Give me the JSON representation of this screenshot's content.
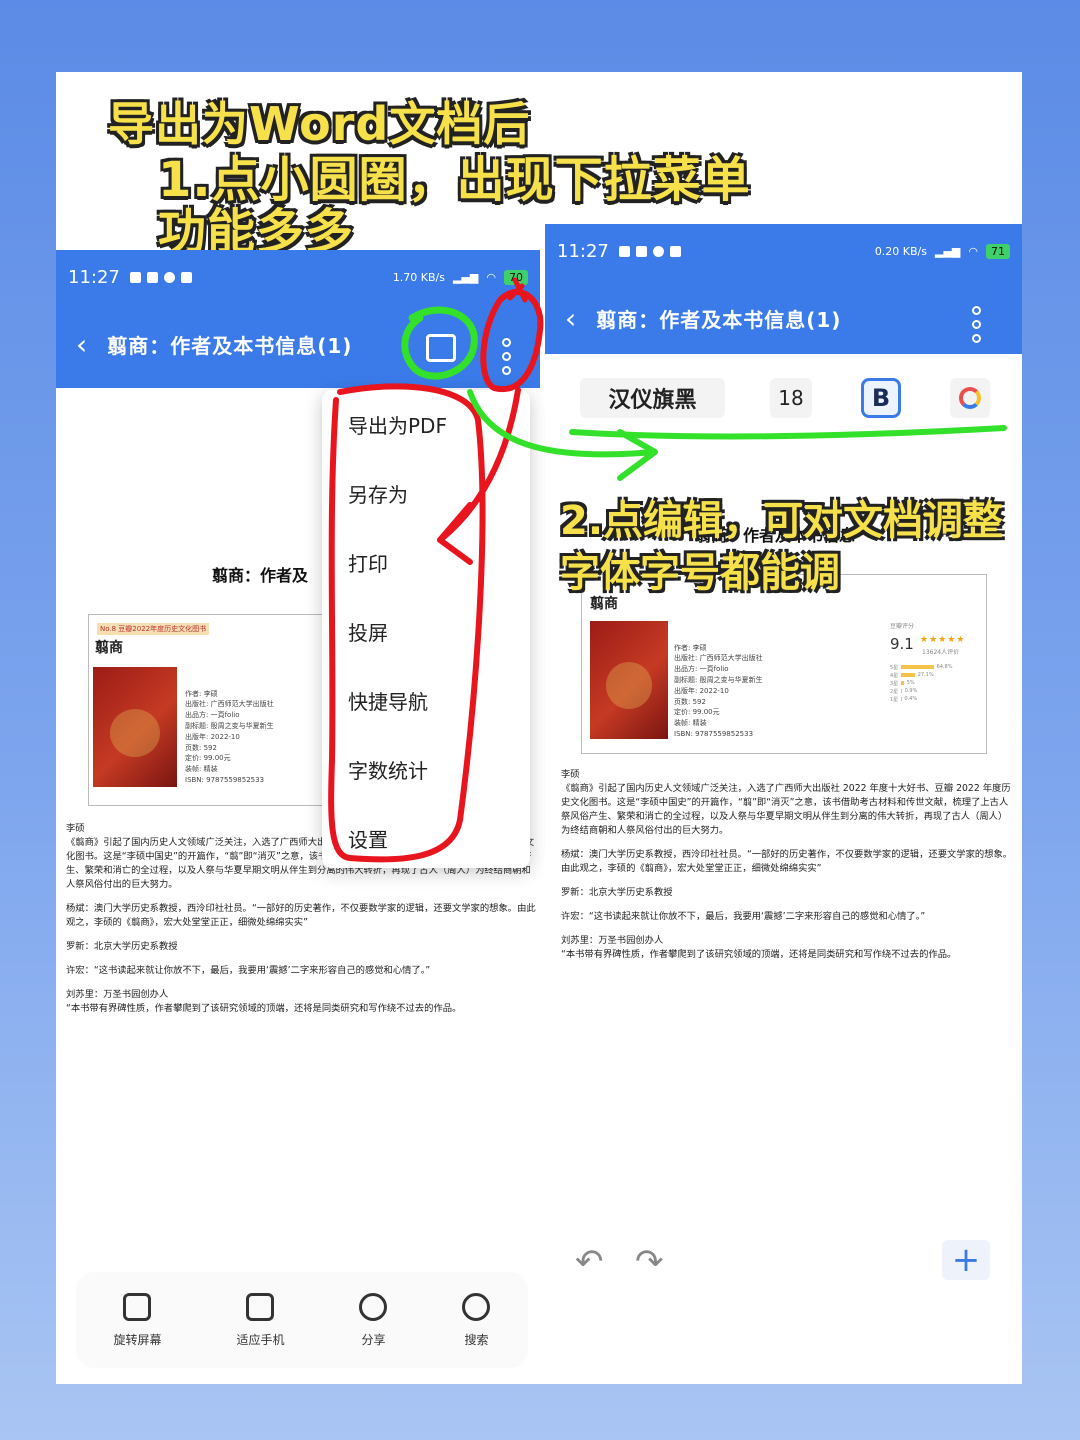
{
  "headline": {
    "line1": "导出为Word文档后",
    "line2": "1.点小圆圈，出现下拉菜单",
    "line3": "功能多多"
  },
  "step2": {
    "line1": "2.点编辑，可对文档调整",
    "line2": "字体字号都能调"
  },
  "left_phone": {
    "status": {
      "time": "11:27",
      "net_speed": "1.70 KB/s",
      "battery": "70"
    },
    "title": "翦商：作者及本书信息(1)",
    "menu": [
      "导出为PDF",
      "另存为",
      "打印",
      "投屏",
      "快捷导航",
      "字数统计",
      "设置"
    ],
    "doc_title": "翦商：作者及",
    "card": {
      "tag": "No.8  豆瓣2022年度历史文化图书",
      "name": "翦商",
      "meta": [
        "作者: 李硕",
        "出版社: 广西师范大学出版社",
        "出品方: 一頁folio",
        "副标题: 殷周之变与华夏新生",
        "出版年: 2022-10",
        "页数: 592",
        "定价: 99.00元",
        "装帧: 精装",
        "ISBN: 9787559852533"
      ]
    },
    "body": [
      "李硕",
      "《翦商》引起了国内历史人文领域广泛关注，入选了广西师大出版社 2022 年度十大好书、豆瓣 2022 年度历史文化图书。这是“李硕中国史”的开篇作，“翦”即“消灭”之意，该书借助考古材料和传世文献，梳理了上古人祭风俗产生、繁荣和消亡的全过程，以及人祭与华夏早期文明从伴生到分离的伟大转折，再现了古人（周人）为终结商朝和人祭风俗付出的巨大努力。",
      "杨斌：澳门大学历史系教授，西泠印社社员。“一部好的历史著作，不仅要数学家的逻辑，还要文学家的想象。由此观之，李硕的《翦商》，宏大处堂堂正正，细微处绵绵实实”",
      "罗新：北京大学历史系教授",
      "许宏：“这书读起来就让你放不下，最后，我要用‘震撼’二字来形容自己的感觉和心情了。”",
      "刘苏里：万圣书园创办人",
      "“本书带有界碑性质，作者攀爬到了该研究领域的顶端，还将是同类研究和写作绕不过去的作品。"
    ],
    "bottom_tools": [
      "旋转屏幕",
      "适应手机",
      "分享",
      "搜索"
    ]
  },
  "right_phone": {
    "status": {
      "time": "11:27",
      "net_speed": "0.20 KB/s",
      "battery": "71"
    },
    "title": "翦商：作者及本书信息(1)",
    "toolbar": {
      "font": "汉仪旗黑",
      "size": "18",
      "bold": "B"
    },
    "doc_title": "翦商：作者及本书信息",
    "card": {
      "name": "翦商",
      "meta": [
        "作者: 李硕",
        "出版社: 广西师范大学出版社",
        "出品方: 一頁folio",
        "副标题: 殷周之变与华夏新生",
        "出版年: 2022-10",
        "页数: 592",
        "定价: 99.00元",
        "装帧: 精装",
        "ISBN: 9787559852533"
      ],
      "rating_label": "豆瓣评分",
      "rating": "9.1",
      "stars": "★★★★★",
      "rating_count": "13624人评价",
      "rating_bars": [
        {
          "label": "5星",
          "pct": 64.8
        },
        {
          "label": "4星",
          "pct": 27.1
        },
        {
          "label": "3星",
          "pct": 5.0
        },
        {
          "label": "2星",
          "pct": 0.9
        },
        {
          "label": "1星",
          "pct": 0.4
        }
      ]
    },
    "body": [
      "李硕",
      "《翦商》引起了国内历史人文领域广泛关注，入选了广西师大出版社 2022 年度十大好书、豆瓣 2022 年度历史文化图书。这是“李硕中国史”的开篇作，“翦”即“消灭”之意，该书借助考古材料和传世文献，梳理了上古人祭风俗产生、繁荣和消亡的全过程，以及人祭与华夏早期文明从伴生到分离的伟大转折，再现了古人（周人）为终结商朝和人祭风俗付出的巨大努力。",
      "杨斌：澳门大学历史系教授，西泠印社社员。“一部好的历史著作，不仅要数学家的逻辑，还要文学家的想象。由此观之，李硕的《翦商》，宏大处堂堂正正，细微处绵绵实实”",
      "罗新：北京大学历史系教授",
      "许宏：“这书读起来就让你放不下，最后，我要用‘震撼’二字来形容自己的感觉和心情了。”",
      "刘苏里：万圣书园创办人",
      "“本书带有界碑性质，作者攀爬到了该研究领域的顶端，还将是同类研究和写作绕不过去的作品。"
    ],
    "icons": {
      "undo": "undo-icon",
      "redo": "redo-icon",
      "add": "plus-icon"
    }
  },
  "colors": {
    "accent": "#3b7be9",
    "annotation_red": "#e8141e",
    "annotation_green": "#33e02a",
    "headline_yellow": "#f6e14a"
  }
}
